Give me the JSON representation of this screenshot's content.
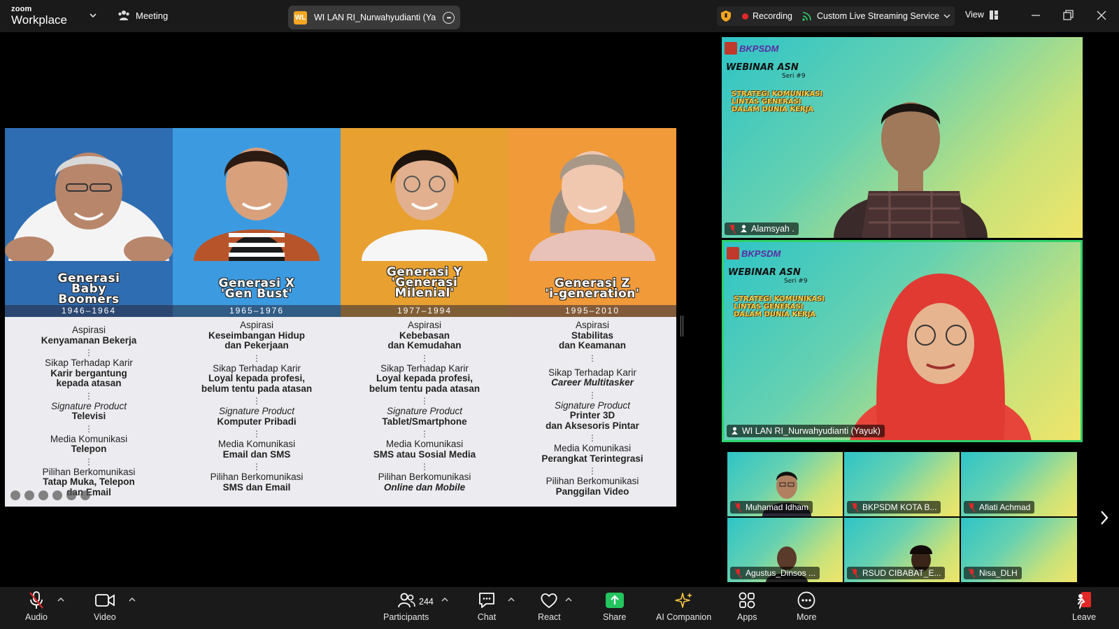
{
  "app": {
    "brand_top": "zoom",
    "brand_bottom": "Workplace",
    "meeting_label": "Meeting",
    "active_speaker_badge": "WL",
    "active_speaker": "WI LAN RI_Nurwahyudianti (Yayu",
    "recording_label": "Recording",
    "streaming_label": "Custom Live Streaming Service",
    "view_label": "View"
  },
  "slide": {
    "columns": [
      {
        "title": "Generasi\nBaby\nBoomers",
        "years": "1946–1964",
        "color": "#2f6db2",
        "sections": [
          {
            "label": "Aspirasi",
            "value": "Kenyamanan Bekerja",
            "label_italic": false,
            "value_italic": false
          },
          {
            "label": "Sikap Terhadap Karir",
            "value": "Karir bergantung\nkepada atasan",
            "label_italic": false,
            "value_italic": false
          },
          {
            "label": "Signature Product",
            "value": "Televisi",
            "label_italic": true,
            "value_italic": false
          },
          {
            "label": "Media Komunikasi",
            "value": "Telepon",
            "label_italic": false,
            "value_italic": false
          },
          {
            "label": "Pilihan Berkomunikasi",
            "value": "Tatap Muka, Telepon\ndan Email",
            "label_italic": false,
            "value_italic": false
          }
        ]
      },
      {
        "title": "Generasi X\n'Gen Bust'",
        "years": "1965–1976",
        "color": "#3c9be0",
        "sections": [
          {
            "label": "Aspirasi",
            "value": "Keseimbangan Hidup\ndan Pekerjaan",
            "label_italic": false,
            "value_italic": false
          },
          {
            "label": "Sikap Terhadap Karir",
            "value": "Loyal kepada profesi,\nbelum tentu pada atasan",
            "label_italic": false,
            "value_italic": false
          },
          {
            "label": "Signature Product",
            "value": "Komputer Pribadi",
            "label_italic": true,
            "value_italic": false
          },
          {
            "label": "Media Komunikasi",
            "value": "Email dan SMS",
            "label_italic": false,
            "value_italic": false
          },
          {
            "label": "Pilihan Berkomunikasi",
            "value": "SMS dan Email",
            "label_italic": false,
            "value_italic": false
          }
        ]
      },
      {
        "title": "Generasi Y\n'Generasi\nMilenial'",
        "years": "1977–1994",
        "color": "#e8a030",
        "sections": [
          {
            "label": "Aspirasi",
            "value": "Kebebasan\ndan Kemudahan",
            "label_italic": false,
            "value_italic": false
          },
          {
            "label": "Sikap Terhadap Karir",
            "value": "Loyal kepada profesi,\nbelum tentu pada atasan",
            "label_italic": false,
            "value_italic": false
          },
          {
            "label": "Signature Product",
            "value": "Tablet/Smartphone",
            "label_italic": true,
            "value_italic": false
          },
          {
            "label": "Media Komunikasi",
            "value": "SMS atau Sosial Media",
            "label_italic": false,
            "value_italic": false
          },
          {
            "label": "Pilihan Berkomunikasi",
            "value": "Online dan Mobile",
            "label_italic": false,
            "value_italic": true
          }
        ]
      },
      {
        "title": "Generasi Z\n'i-generation'",
        "years": "1995–2010",
        "color": "#f09a3a",
        "sections": [
          {
            "label": "Aspirasi",
            "value": "Stabilitas\ndan Keamanan",
            "label_italic": false,
            "value_italic": false
          },
          {
            "label": "Sikap Terhadap Karir",
            "value": "Career Multitasker",
            "label_italic": false,
            "value_italic": true
          },
          {
            "label": "Signature Product",
            "value": "Printer 3D\ndan Aksesoris Pintar",
            "label_italic": true,
            "value_italic": false
          },
          {
            "label": "Media Komunikasi",
            "value": "Perangkat Terintegrasi",
            "label_italic": false,
            "value_italic": false
          },
          {
            "label": "Pilihan Berkomunikasi",
            "value": "Panggilan Video",
            "label_italic": false,
            "value_italic": false
          }
        ]
      }
    ]
  },
  "webinar_bg": {
    "title": "WEBINAR ASN",
    "series": "Seri #9",
    "subtitle": "STRATEGI KOMUNIKASI\nLINTAS GENERASI\nDALAM DUNIA KERJA",
    "logo_text": "BKPSDM"
  },
  "participants": {
    "big": [
      {
        "name": "Alamsyah ."
      },
      {
        "name": "WI LAN RI_Nurwahyudianti (Yayuk)"
      }
    ],
    "small": [
      {
        "name": "Muhamad Idham"
      },
      {
        "name": "BKPSDM KOTA B..."
      },
      {
        "name": "Afiati Achmad"
      },
      {
        "name": "Agustus_Dinsos ..."
      },
      {
        "name": "RSUD CIBABAT_E..."
      },
      {
        "name": "Nisa_DLH"
      }
    ]
  },
  "toolbar": {
    "audio": "Audio",
    "video": "Video",
    "participants": "Participants",
    "participants_count": "244",
    "chat": "Chat",
    "react": "React",
    "share": "Share",
    "ai": "AI Companion",
    "apps": "Apps",
    "more": "More",
    "leave": "Leave"
  },
  "colors": {
    "accent_green": "#2ed26a",
    "share_green": "#23c55e",
    "recording_red": "#e02828",
    "leave_red": "#e02828"
  }
}
